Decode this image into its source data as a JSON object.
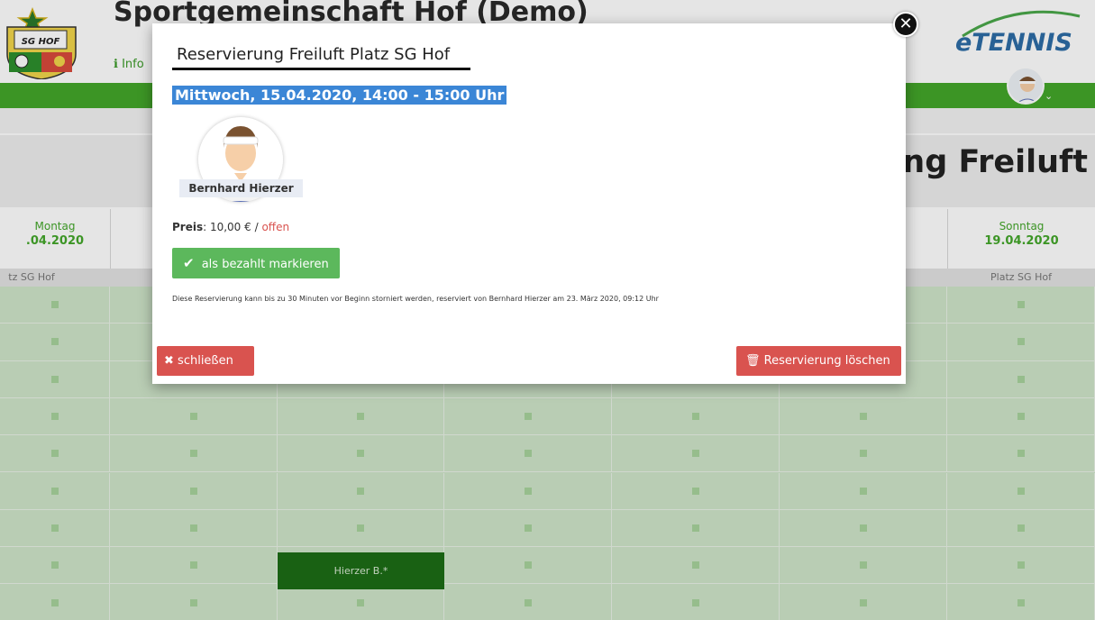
{
  "header": {
    "club_title": "Sportgemeinschaft Hof (Demo)",
    "info_label": "Info",
    "app_logo": "eTENNIS",
    "logo_text": "SG HOF",
    "user_icon": "user-avatar-icon"
  },
  "page": {
    "big_title": "ung Freiluft"
  },
  "days": [
    {
      "name": "Montag",
      "date": ".04.2020"
    },
    {
      "name": "Sonntag",
      "date": "19.04.2020"
    }
  ],
  "courts": [
    "tz SG Hof",
    "Platz SG Hof"
  ],
  "booking": {
    "label": "Hierzer B.*"
  },
  "modal": {
    "title": "Reservierung Freiluft Platz SG Hof",
    "date": "Mittwoch, 15.04.2020, 14:00 - 15:00 Uhr",
    "player_name": "Bernhard Hierzer",
    "price_label": "Preis",
    "price_value": ": 10,00 € / ",
    "price_status": "offen",
    "paid_button": "als bezahlt markieren",
    "note": "Diese Reservierung kann bis zu 30 Minuten vor Beginn storniert werden, reserviert von Bernhard Hierzer am 23. März 2020, 09:12 Uhr",
    "close_button": "schließen",
    "delete_button": "Reservierung löschen"
  },
  "colors": {
    "accent_green": "#43a62a",
    "danger_red": "#d9534f",
    "success_green": "#5cb85c",
    "booked_dark_green": "#1c6c16"
  }
}
